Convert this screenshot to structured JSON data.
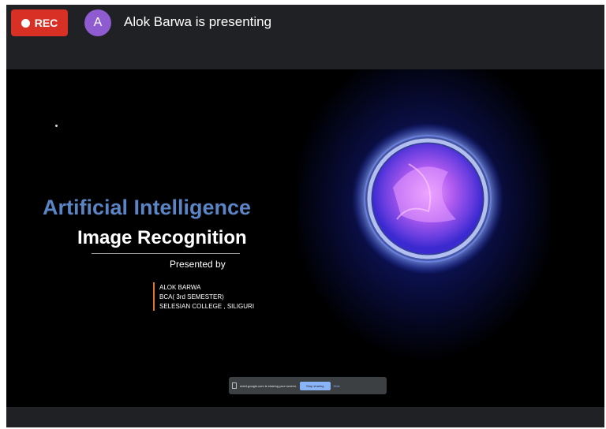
{
  "topbar": {
    "rec_label": "REC",
    "avatar_initial": "A",
    "presenter_text": "Alok Barwa is presenting"
  },
  "slide": {
    "title": "Artificial Intelligence",
    "subtitle": "Image Recognition",
    "presented_by": "Presented by",
    "author_lines": [
      "ALOK BARWA",
      "BCA( 3rd SEMESTER)",
      "SELESIAN COLLEGE , SILIGURI"
    ]
  },
  "share_bar": {
    "message": "meet.google.com is sharing your screen.",
    "stop_label": "Stop sharing",
    "hide_label": "Hide"
  },
  "colors": {
    "rec": "#d93025",
    "avatar": "#8e5bd0",
    "title": "#5b84c4",
    "accent_bar": "#e0762b",
    "stop_button": "#8ab4f8"
  }
}
